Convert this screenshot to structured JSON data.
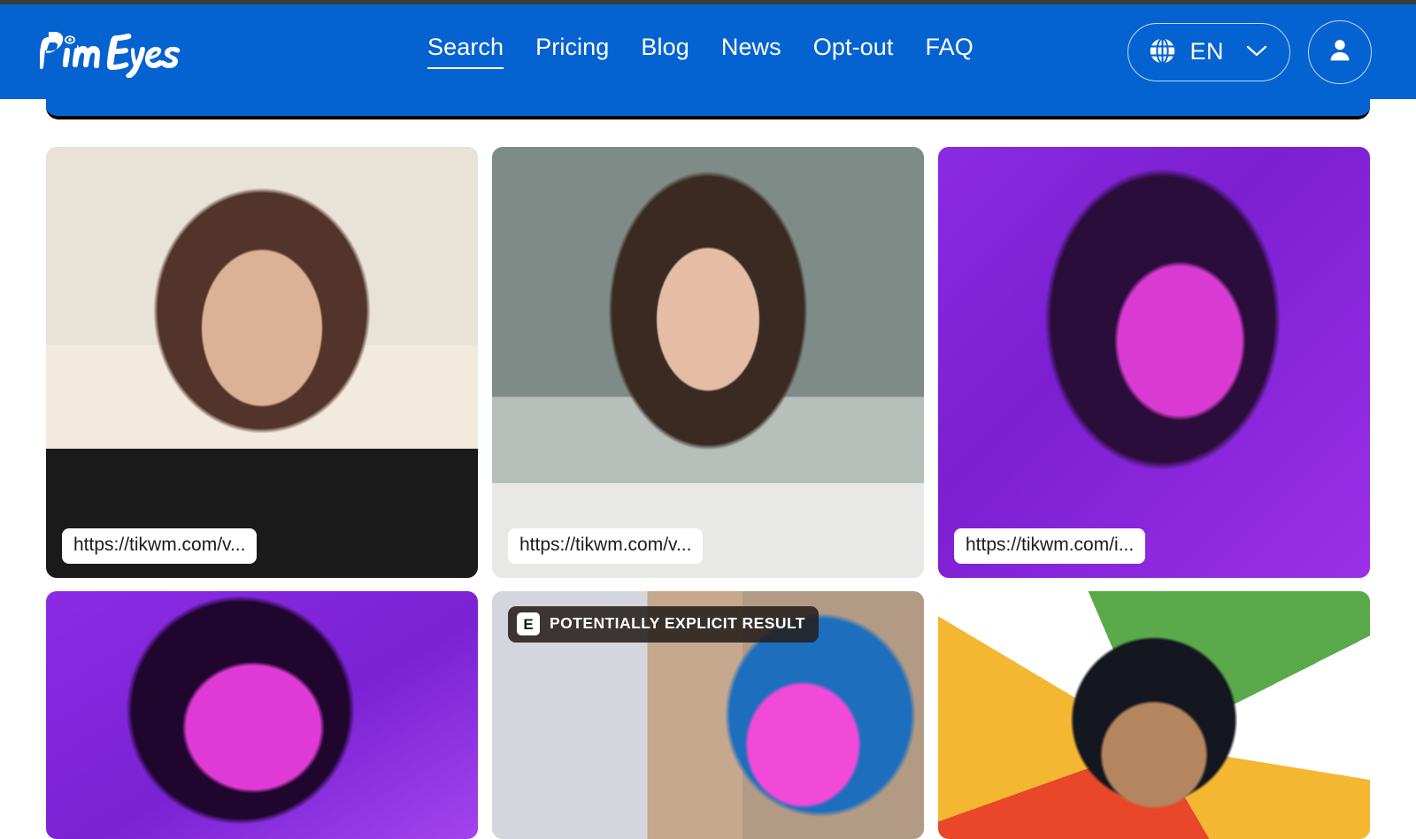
{
  "app": {
    "brand": "PimEyes",
    "brand_icon": "pimeyes-logo",
    "accent_color": "#0563d1",
    "chrome_color": "#3b3b3b"
  },
  "nav": {
    "items": [
      {
        "label": "Search",
        "name": "search",
        "active": true
      },
      {
        "label": "Pricing",
        "name": "pricing",
        "active": false
      },
      {
        "label": "Blog",
        "name": "blog",
        "active": false
      },
      {
        "label": "News",
        "name": "news",
        "active": false
      },
      {
        "label": "Opt-out",
        "name": "opt-out",
        "active": false
      },
      {
        "label": "FAQ",
        "name": "faq",
        "active": false
      }
    ],
    "language": {
      "code": "EN",
      "globe_icon": "globe-icon",
      "chevron_icon": "chevron-down-icon"
    },
    "account": {
      "icon": "user-avatar-icon",
      "label": "Account"
    }
  },
  "results": {
    "cards": [
      {
        "name": "result-card-1",
        "thumb_class": "t1",
        "url_label": "https://tikwm.com/v...",
        "explicit": false,
        "short": false
      },
      {
        "name": "result-card-2",
        "thumb_class": "t2",
        "url_label": "https://tikwm.com/v...",
        "explicit": false,
        "short": false
      },
      {
        "name": "result-card-3",
        "thumb_class": "t3",
        "url_label": "https://tikwm.com/i...",
        "explicit": false,
        "short": false
      },
      {
        "name": "result-card-4",
        "thumb_class": "t4",
        "url_label": "",
        "explicit": false,
        "short": true
      },
      {
        "name": "result-card-5",
        "thumb_class": "t5",
        "url_label": "",
        "explicit": true,
        "short": true
      },
      {
        "name": "result-card-6",
        "thumb_class": "t6",
        "url_label": "",
        "explicit": false,
        "short": true
      }
    ],
    "explicit_badge": {
      "mark": "E",
      "text": "POTENTIALLY EXPLICIT RESULT"
    }
  }
}
